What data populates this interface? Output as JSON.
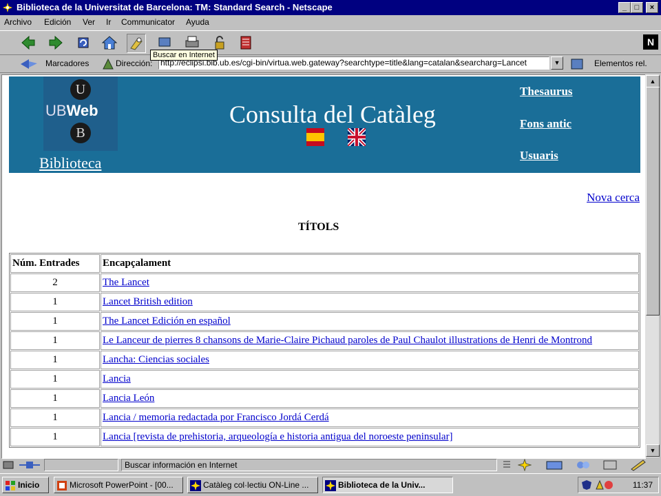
{
  "window": {
    "title": "Biblioteca de la Universitat de Barcelona: TM: Standard Search - Netscape",
    "controls": [
      "minimize",
      "maximize",
      "close"
    ]
  },
  "menu": [
    "Archivo",
    "Edición",
    "Ver",
    "Ir",
    "Communicator",
    "Ayuda"
  ],
  "toolbar": {
    "buttons": [
      "back-icon",
      "forward-icon",
      "reload-icon",
      "home-icon",
      "search-icon",
      "guide-icon",
      "print-icon",
      "security-icon",
      "stop-icon"
    ],
    "tooltip": "Buscar en Internet"
  },
  "location": {
    "bookmarks_label": "Marcadores",
    "address_label": "Dirección:",
    "url": "http://eclipsi.bib.ub.es/cgi-bin/virtua.web.gateway?searchtype=title&lang=catalan&searcharg=Lancet",
    "related_label": "Elementos rel."
  },
  "page": {
    "logo_letters": [
      "U",
      "B"
    ],
    "logo_ub": "UB",
    "logo_web": "Web",
    "biblioteca": "Biblioteca",
    "heading": "Consulta del Catàleg",
    "top_links": [
      "Thesaurus",
      "Fons antic",
      "Usuaris"
    ],
    "nova_cerca": "Nova cerca",
    "section_title": "TÍTOLS",
    "columns": [
      "Núm. Entrades",
      "Encapçalament"
    ],
    "rows": [
      {
        "count": "2",
        "heading": "The Lancet"
      },
      {
        "count": "1",
        "heading": "Lancet British edition"
      },
      {
        "count": "1",
        "heading": "The Lancet Edición en español"
      },
      {
        "count": "1",
        "heading": "Le Lanceur de pierres 8 chansons de Marie-Claire Pichaud paroles de Paul Chaulot illustrations de Henri de Montrond"
      },
      {
        "count": "1",
        "heading": "Lancha: Ciencias sociales"
      },
      {
        "count": "1",
        "heading": "Lancia"
      },
      {
        "count": "1",
        "heading": "Lancia León"
      },
      {
        "count": "1",
        "heading": "Lancia / memoria redactada por Francisco Jordá Cerdá"
      },
      {
        "count": "1",
        "heading": "Lancia [revista de prehistoria, arqueología e historia antigua del noroeste peninsular]"
      }
    ]
  },
  "status": {
    "text": "Buscar información en Internet"
  },
  "taskbar": {
    "start": "Inicio",
    "tasks": [
      {
        "label": "Microsoft PowerPoint - [00...",
        "active": false
      },
      {
        "label": "Catàleg col·lectiu ON-Line ...",
        "active": false
      },
      {
        "label": "Biblioteca de la Univ...",
        "active": true
      }
    ],
    "clock": "11:37"
  },
  "colors": {
    "titlebar": "#000080",
    "banner": "#1a6e98",
    "link": "#0000cc"
  }
}
